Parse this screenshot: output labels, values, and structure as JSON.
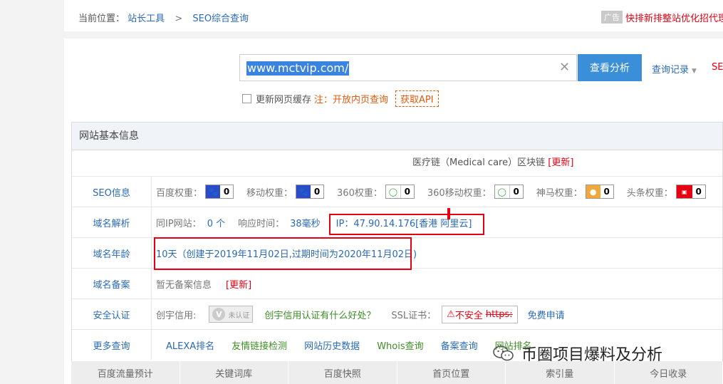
{
  "breadcrumb": {
    "prefix": "当前位置：",
    "home": "站长工具",
    "sep": ">",
    "current": "SEO综合查询"
  },
  "ad": {
    "tag": "广告",
    "text": "快排新排整站优化招代理"
  },
  "search": {
    "value": "www.mctvip.com/",
    "clear_icon": "close-icon",
    "analyze_label": "查看分析",
    "history_label": "查询记录",
    "se_trunc": "SE"
  },
  "options": {
    "refresh_label": "更新网页缓存",
    "note": "注：开放内页查询",
    "api_label": "获取API"
  },
  "info": {
    "title": "网站基本信息",
    "chain": "医疗链（Medical care）区块链",
    "update": "[更新]",
    "seo": {
      "label": "SEO信息",
      "weights": [
        {
          "label": "百度权重：",
          "icon": "baidu-paw-icon",
          "value": "0"
        },
        {
          "label": "移动权重：",
          "icon": "baidu-paw-icon",
          "value": "0"
        },
        {
          "label": "360权重：",
          "icon": "360-icon",
          "value": "0"
        },
        {
          "label": "360移动权重：",
          "icon": "360-icon",
          "value": "0"
        },
        {
          "label": "神马权重：",
          "icon": "shenma-icon",
          "value": "0"
        },
        {
          "label": "头条权重：",
          "icon": "toutiao-icon",
          "value": "0"
        }
      ]
    },
    "dns": {
      "label": "域名解析",
      "same_ip_label": "同IP网站：",
      "same_ip_value": "0 个",
      "resp_label": "响应时间：",
      "resp_value": "38毫秒",
      "ip": "IP：47.90.14.176[香港 阿里云]"
    },
    "age": {
      "label": "域名年龄",
      "value": "10天（创建于2019年11月02日,过期时间为2020年11月02日)"
    },
    "icp": {
      "label": "域名备案",
      "value": "暂无备案信息",
      "update": "[更新]"
    },
    "security": {
      "label": "安全认证",
      "trust_label": "创宇信用:",
      "trust_logo_text": "未认证",
      "trust_link": "创宇信用认证有什么好处？",
      "ssl_label": "SSL证书：",
      "ssl_warn": "不安全",
      "ssl_https": "https:",
      "free_apply": "免费申请"
    },
    "more": {
      "label": "更多查询",
      "links": [
        "ALEXA排名",
        "友情链接检测",
        "网站历史数据",
        "Whois查询",
        "备案查询",
        "网站排名"
      ]
    }
  },
  "bottom_tabs": [
    "百度流量预计",
    "关键词库",
    "百度快照",
    "首页位置",
    "索引量",
    "今日收录"
  ],
  "watermark": "币圈项目爆料及分析",
  "colors": {
    "link_blue": "#2a6ab4",
    "button_blue": "#3b8fd9",
    "alert_red": "#e60012",
    "note_orange": "#e05b0c",
    "green": "#3e8e26"
  }
}
